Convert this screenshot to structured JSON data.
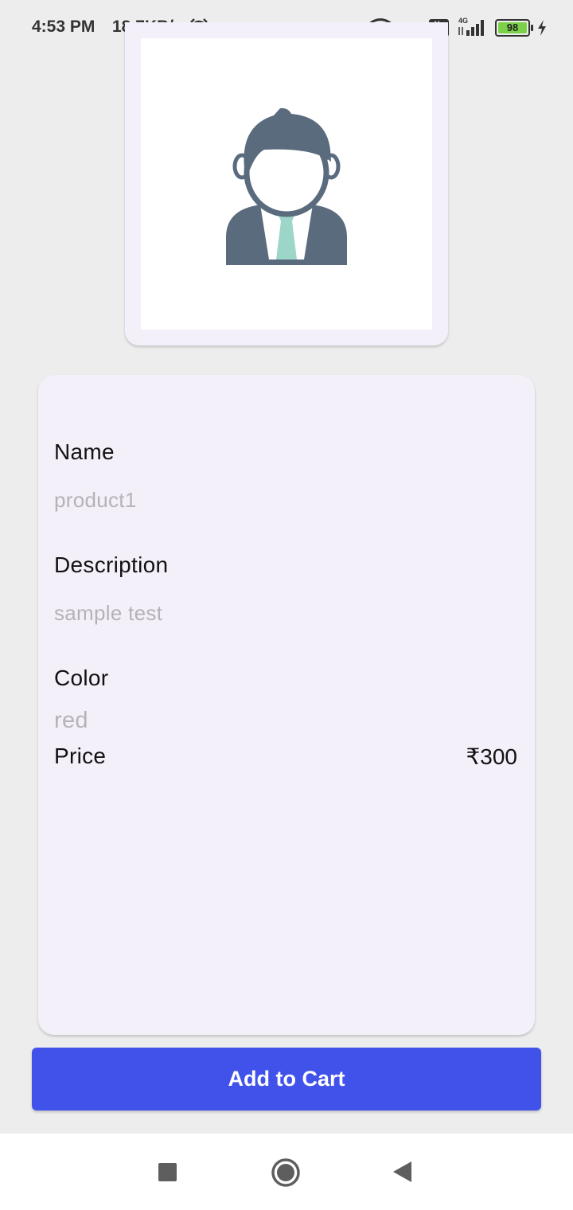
{
  "status_bar": {
    "time": "4:53 PM",
    "network_speed": "18.7KB/s",
    "dots": "• •",
    "volte_label": "Vo\nLTE",
    "network_type": "4G",
    "battery_level": "98",
    "icons": [
      "alarm-icon",
      "wifi-icon",
      "signal-icon",
      "volte-icon",
      "signal-4g-icon",
      "battery-icon",
      "charging-icon"
    ]
  },
  "product_image": {
    "icon": "businessman-avatar-icon",
    "colors": {
      "figure": "#596B7D",
      "tie": "#9CD6C9"
    }
  },
  "details": {
    "name_label": "Name",
    "name_value": "product1",
    "description_label": "Description",
    "description_value": "sample test",
    "color_label": "Color",
    "color_value": "red",
    "price_label": "Price",
    "price_value": "₹300"
  },
  "actions": {
    "add_to_cart_label": "Add to Cart",
    "button_color": "#4152EB"
  },
  "nav_bar": {
    "icons": [
      "recents-icon",
      "home-icon",
      "back-icon"
    ]
  }
}
